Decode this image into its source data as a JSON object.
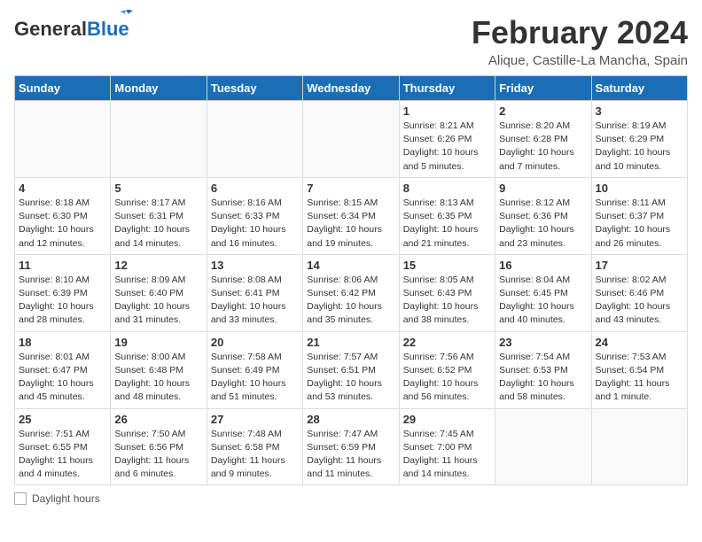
{
  "header": {
    "logo_general": "General",
    "logo_blue": "Blue",
    "main_title": "February 2024",
    "sub_title": "Alique, Castille-La Mancha, Spain"
  },
  "days_of_week": [
    "Sunday",
    "Monday",
    "Tuesday",
    "Wednesday",
    "Thursday",
    "Friday",
    "Saturday"
  ],
  "weeks": [
    [
      {
        "date": "",
        "info": ""
      },
      {
        "date": "",
        "info": ""
      },
      {
        "date": "",
        "info": ""
      },
      {
        "date": "",
        "info": ""
      },
      {
        "date": "1",
        "info": "Sunrise: 8:21 AM\nSunset: 6:26 PM\nDaylight: 10 hours and 5 minutes."
      },
      {
        "date": "2",
        "info": "Sunrise: 8:20 AM\nSunset: 6:28 PM\nDaylight: 10 hours and 7 minutes."
      },
      {
        "date": "3",
        "info": "Sunrise: 8:19 AM\nSunset: 6:29 PM\nDaylight: 10 hours and 10 minutes."
      }
    ],
    [
      {
        "date": "4",
        "info": "Sunrise: 8:18 AM\nSunset: 6:30 PM\nDaylight: 10 hours and 12 minutes."
      },
      {
        "date": "5",
        "info": "Sunrise: 8:17 AM\nSunset: 6:31 PM\nDaylight: 10 hours and 14 minutes."
      },
      {
        "date": "6",
        "info": "Sunrise: 8:16 AM\nSunset: 6:33 PM\nDaylight: 10 hours and 16 minutes."
      },
      {
        "date": "7",
        "info": "Sunrise: 8:15 AM\nSunset: 6:34 PM\nDaylight: 10 hours and 19 minutes."
      },
      {
        "date": "8",
        "info": "Sunrise: 8:13 AM\nSunset: 6:35 PM\nDaylight: 10 hours and 21 minutes."
      },
      {
        "date": "9",
        "info": "Sunrise: 8:12 AM\nSunset: 6:36 PM\nDaylight: 10 hours and 23 minutes."
      },
      {
        "date": "10",
        "info": "Sunrise: 8:11 AM\nSunset: 6:37 PM\nDaylight: 10 hours and 26 minutes."
      }
    ],
    [
      {
        "date": "11",
        "info": "Sunrise: 8:10 AM\nSunset: 6:39 PM\nDaylight: 10 hours and 28 minutes."
      },
      {
        "date": "12",
        "info": "Sunrise: 8:09 AM\nSunset: 6:40 PM\nDaylight: 10 hours and 31 minutes."
      },
      {
        "date": "13",
        "info": "Sunrise: 8:08 AM\nSunset: 6:41 PM\nDaylight: 10 hours and 33 minutes."
      },
      {
        "date": "14",
        "info": "Sunrise: 8:06 AM\nSunset: 6:42 PM\nDaylight: 10 hours and 35 minutes."
      },
      {
        "date": "15",
        "info": "Sunrise: 8:05 AM\nSunset: 6:43 PM\nDaylight: 10 hours and 38 minutes."
      },
      {
        "date": "16",
        "info": "Sunrise: 8:04 AM\nSunset: 6:45 PM\nDaylight: 10 hours and 40 minutes."
      },
      {
        "date": "17",
        "info": "Sunrise: 8:02 AM\nSunset: 6:46 PM\nDaylight: 10 hours and 43 minutes."
      }
    ],
    [
      {
        "date": "18",
        "info": "Sunrise: 8:01 AM\nSunset: 6:47 PM\nDaylight: 10 hours and 45 minutes."
      },
      {
        "date": "19",
        "info": "Sunrise: 8:00 AM\nSunset: 6:48 PM\nDaylight: 10 hours and 48 minutes."
      },
      {
        "date": "20",
        "info": "Sunrise: 7:58 AM\nSunset: 6:49 PM\nDaylight: 10 hours and 51 minutes."
      },
      {
        "date": "21",
        "info": "Sunrise: 7:57 AM\nSunset: 6:51 PM\nDaylight: 10 hours and 53 minutes."
      },
      {
        "date": "22",
        "info": "Sunrise: 7:56 AM\nSunset: 6:52 PM\nDaylight: 10 hours and 56 minutes."
      },
      {
        "date": "23",
        "info": "Sunrise: 7:54 AM\nSunset: 6:53 PM\nDaylight: 10 hours and 58 minutes."
      },
      {
        "date": "24",
        "info": "Sunrise: 7:53 AM\nSunset: 6:54 PM\nDaylight: 11 hours and 1 minute."
      }
    ],
    [
      {
        "date": "25",
        "info": "Sunrise: 7:51 AM\nSunset: 6:55 PM\nDaylight: 11 hours and 4 minutes."
      },
      {
        "date": "26",
        "info": "Sunrise: 7:50 AM\nSunset: 6:56 PM\nDaylight: 11 hours and 6 minutes."
      },
      {
        "date": "27",
        "info": "Sunrise: 7:48 AM\nSunset: 6:58 PM\nDaylight: 11 hours and 9 minutes."
      },
      {
        "date": "28",
        "info": "Sunrise: 7:47 AM\nSunset: 6:59 PM\nDaylight: 11 hours and 11 minutes."
      },
      {
        "date": "29",
        "info": "Sunrise: 7:45 AM\nSunset: 7:00 PM\nDaylight: 11 hours and 14 minutes."
      },
      {
        "date": "",
        "info": ""
      },
      {
        "date": "",
        "info": ""
      }
    ]
  ],
  "footer": {
    "daylight_label": "Daylight hours"
  }
}
